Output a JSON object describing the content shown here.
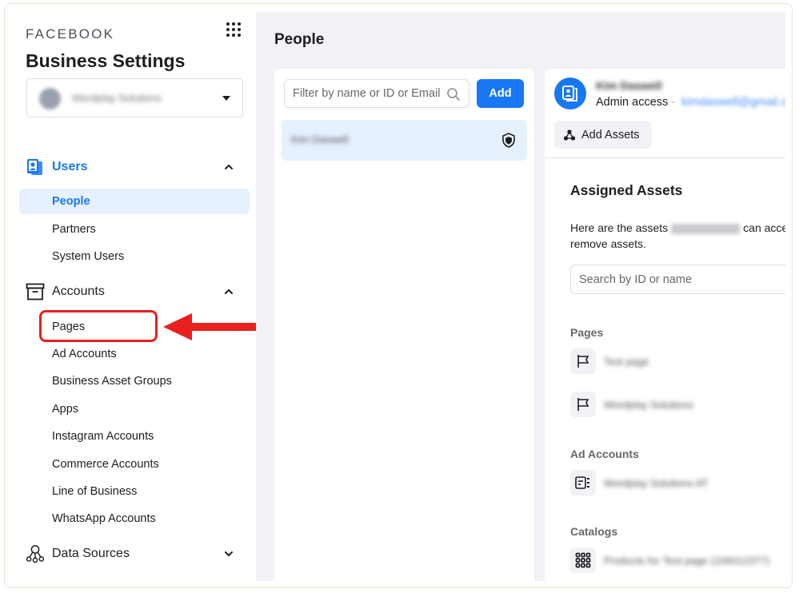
{
  "sidebar": {
    "brand": "FACEBOOK",
    "title": "Business Settings",
    "business_selector": {
      "name": "Wordplay Solutions"
    },
    "sections": [
      {
        "label": "Users",
        "icon": "users-icon",
        "expanded": true,
        "items": [
          {
            "label": "People",
            "selected": true
          },
          {
            "label": "Partners"
          },
          {
            "label": "System Users"
          }
        ]
      },
      {
        "label": "Accounts",
        "icon": "archive-box-icon",
        "expanded": true,
        "items": [
          {
            "label": "Pages",
            "highlighted": true
          },
          {
            "label": "Ad Accounts"
          },
          {
            "label": "Business Asset Groups"
          },
          {
            "label": "Apps"
          },
          {
            "label": "Instagram Accounts"
          },
          {
            "label": "Commerce Accounts"
          },
          {
            "label": "Line of Business"
          },
          {
            "label": "WhatsApp Accounts"
          }
        ]
      },
      {
        "label": "Data Sources",
        "icon": "data-sources-icon",
        "expanded": false,
        "items": []
      }
    ]
  },
  "main": {
    "title": "People",
    "people_list": {
      "filter_placeholder": "Filter by name or ID or Email",
      "add_label": "Add",
      "people": [
        {
          "name": "Kim Daswell",
          "role_icon": "admin-shield-icon",
          "selected": true
        }
      ]
    },
    "detail": {
      "user_name": "Kim Daswell",
      "access_label": "Admin access",
      "separator": "·",
      "email": "kimdaswell@gmail.com",
      "add_assets_label": "Add Assets",
      "assigned_title": "Assigned Assets",
      "desc_prefix": "Here are the assets",
      "desc_name": "Kim Daswell",
      "desc_suffix": "can acce",
      "desc_line2": "remove assets.",
      "search_placeholder": "Search by ID or name",
      "groups": [
        {
          "label": "Pages",
          "items": [
            {
              "name": "Test page",
              "icon": "flag-icon"
            },
            {
              "name": "Wordplay Solutions",
              "icon": "flag-icon"
            }
          ]
        },
        {
          "label": "Ad Accounts",
          "items": [
            {
              "name": "Wordplay Solutions AT",
              "icon": "ad-account-icon"
            }
          ]
        },
        {
          "label": "Catalogs",
          "items": [
            {
              "name": "Products for Test page (100012377)",
              "icon": "catalog-grid-icon"
            }
          ]
        }
      ]
    }
  },
  "annotation": {
    "target": "Pages",
    "color": "#e8201f"
  },
  "colors": {
    "accent": "#1877f2",
    "selected_bg": "#e7f0fd",
    "main_bg": "#f0f2f5"
  }
}
